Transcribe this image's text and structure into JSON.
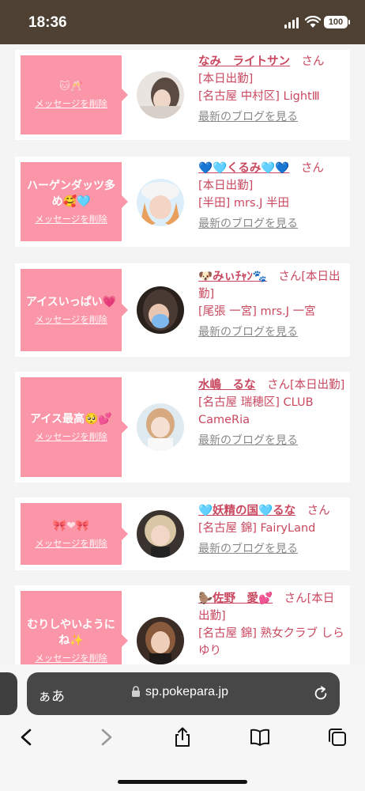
{
  "status": {
    "time": "18:36",
    "battery": "100"
  },
  "browser": {
    "aa_label": "ぁあ",
    "url": "sp.pokepara.jp"
  },
  "labels": {
    "delete": "メッセージを削除",
    "blog": "最新のブログを見る",
    "san": "さん"
  },
  "cards": [
    {
      "message": "🐱🥂",
      "name": "なみ　ライトサン",
      "details": [
        "[本日出勤]",
        "[名古屋 中村区] LightⅢ"
      ]
    },
    {
      "message": "ハーゲンダッツ多め🥰🩵",
      "name": "💙🩵くるみ🩵💙",
      "details": [
        "[本日出勤]",
        "[半田] mrs.J 半田"
      ]
    },
    {
      "message": "アイスいっぱい💗",
      "name": "🐶みぃﾁｬﾝ🐾",
      "suffix": "[本日出勤]",
      "details": [
        "[尾張 一宮] mrs.J 一宮"
      ]
    },
    {
      "message": "アイス最高🥺💕",
      "name": "水嶋　るな",
      "suffix": "[本日出勤]",
      "details": [
        "[名古屋 瑞穂区] CLUB CameRia"
      ]
    },
    {
      "message": "🎀❤🎀",
      "name": "🩵妖精の国🩵るな",
      "details": [
        "[名古屋 錦] FairyLand"
      ]
    },
    {
      "message": "むりしやいようにね✨",
      "name": "🦫佐野　愛💕",
      "suffix": "[本日出勤]",
      "details": [
        "[名古屋 錦] 熟女クラブ しらゆり"
      ]
    }
  ]
}
